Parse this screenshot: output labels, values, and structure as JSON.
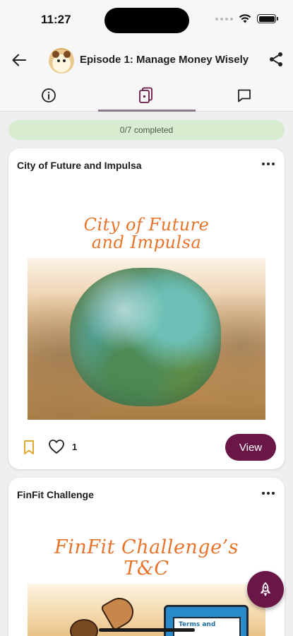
{
  "status_bar": {
    "time": "11:27"
  },
  "header": {
    "title": "Episode 1: Manage Money Wisely",
    "back_icon": "arrow-left-icon",
    "share_icon": "share-icon"
  },
  "tabs": [
    {
      "icon": "info-icon",
      "active": false
    },
    {
      "icon": "cards-icon",
      "active": true
    },
    {
      "icon": "chat-icon",
      "active": false
    }
  ],
  "progress": {
    "label": "0/7 completed",
    "completed": 0,
    "total": 7
  },
  "cards": [
    {
      "title": "City of Future and Impulsa",
      "art_title_line1": "City of Future",
      "art_title_line2": "and Impulsa",
      "likes": "1",
      "view_label": "View"
    },
    {
      "title": "FinFit Challenge",
      "art_title_line1": "FinFit Challenge’s",
      "art_title_line2": "T&C",
      "clipboard_text": "Terms and"
    }
  ],
  "colors": {
    "accent": "#6a1747",
    "progress_bg": "#d8ecd0",
    "art_title": "#e8732a",
    "bookmark": "#e0a82e"
  }
}
